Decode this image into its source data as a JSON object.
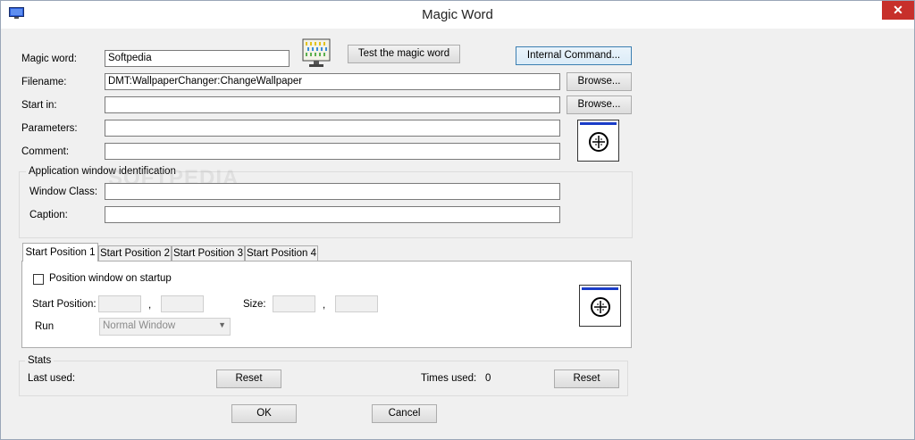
{
  "window": {
    "title": "Magic Word",
    "close_glyph": "✕",
    "app_icon": "monitor-icon"
  },
  "fields": {
    "magic_word_label": "Magic word:",
    "magic_word_value": "Softpedia",
    "filename_label": "Filename:",
    "filename_value": "DMT:WallpaperChanger:ChangeWallpaper",
    "start_in_label": "Start in:",
    "start_in_value": "",
    "parameters_label": "Parameters:",
    "parameters_value": "",
    "comment_label": "Comment:",
    "comment_value": ""
  },
  "buttons": {
    "test": "Test the magic word",
    "internal": "Internal Command...",
    "browse1": "Browse...",
    "browse2": "Browse..."
  },
  "app_window": {
    "group_title": "Application window identification",
    "class_label": "Window Class:",
    "class_value": "",
    "caption_label": "Caption:",
    "caption_value": ""
  },
  "watermark": "SOFTPEDIA",
  "tabs": [
    "Start Position 1",
    "Start Position 2",
    "Start Position 3",
    "Start Position 4"
  ],
  "position": {
    "checkbox_label": "Position window on startup",
    "checked": false,
    "start_label": "Start Position:",
    "size_label": "Size:",
    "comma": ",",
    "run_label": "Run",
    "run_value": "Normal Window"
  },
  "stats": {
    "title": "Stats",
    "last_used_label": "Last used:",
    "times_used_label": "Times used:",
    "times_used_value": "0",
    "reset1": "Reset",
    "reset2": "Reset"
  },
  "dialog": {
    "ok": "OK",
    "cancel": "Cancel"
  }
}
